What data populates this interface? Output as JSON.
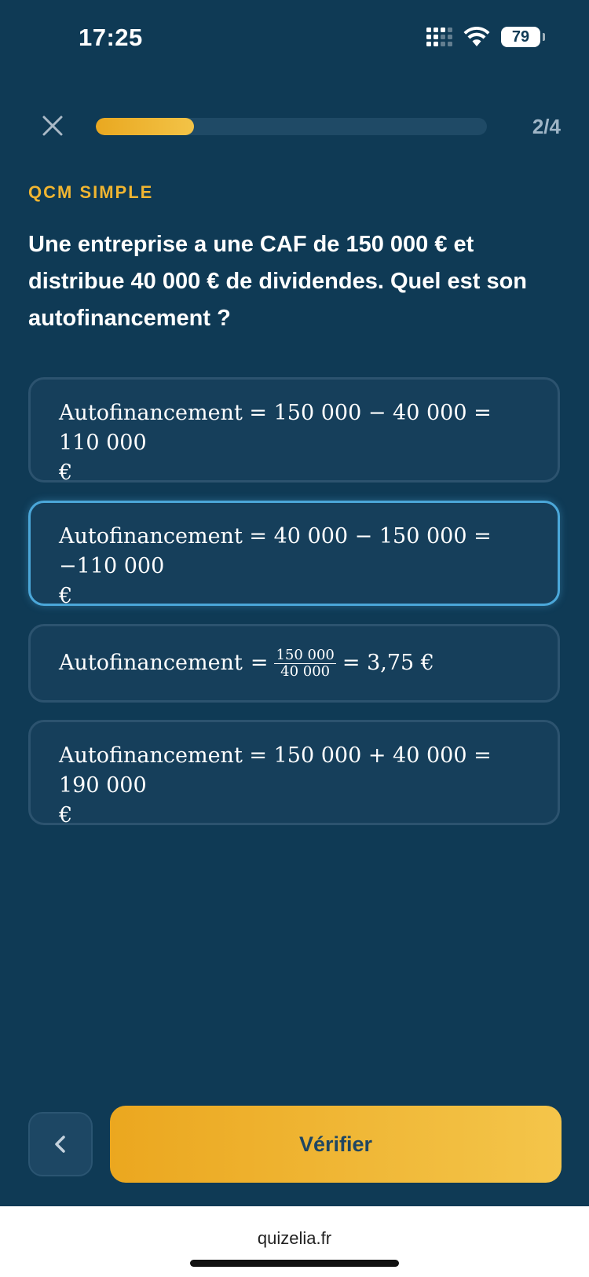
{
  "status_bar": {
    "time": "17:25",
    "battery": "79",
    "signal_icon": "cellular-signal-icon",
    "wifi_icon": "wifi-icon"
  },
  "progress": {
    "current": 2,
    "total": 4,
    "label": "2/4",
    "fill_fraction": 0.25,
    "color": "#f0b531"
  },
  "question": {
    "type": "QCM SIMPLE",
    "text": "Une entreprise a une CAF de 150 000 € et distribue 40 000 € de dividendes. Quel est son autofinancement ?"
  },
  "options": [
    {
      "label": "Autofinancement",
      "expr": "= 150 000 − 40 000 = 110 000",
      "unit": "€",
      "selected": false
    },
    {
      "label": "Autofinancement",
      "expr": "= 40 000 − 150 000 = −110 000",
      "unit": "€",
      "selected": true
    },
    {
      "label": "Autofinancement",
      "eq1": "=",
      "num": "150 000",
      "den": "40 000",
      "expr_after": "= 3,75 €",
      "selected": false
    },
    {
      "label": "Autofinancement",
      "expr": "= 150 000 + 40 000 = 190 000",
      "unit": "€",
      "selected": false
    }
  ],
  "actions": {
    "back_icon": "chevron-left-icon",
    "verify_label": "Vérifier"
  },
  "browser": {
    "url": "quizelia.fr"
  },
  "colors": {
    "background": "#0f3a55",
    "accent": "#f0b531",
    "selected_border": "#4ba7d9"
  }
}
